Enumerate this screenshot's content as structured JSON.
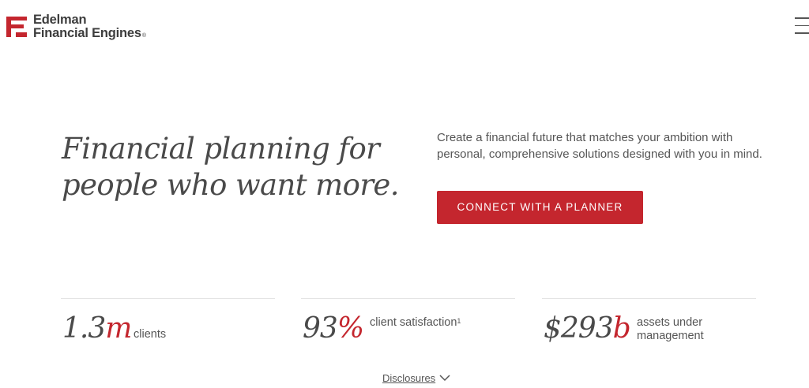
{
  "brand": {
    "name_line1": "Edelman",
    "name_line2": "Financial Engines",
    "registered": "®",
    "accent_color": "#c4262e"
  },
  "header": {
    "menu_icon": "hamburger-menu-icon"
  },
  "hero": {
    "headline_line1": "Financial planning for",
    "headline_line2": "people who want more.",
    "intro": "Create a financial future that matches your ambition with personal, comprehensive solutions designed with you in mind.",
    "cta_label": "CONNECT WITH A PLANNER"
  },
  "stats": [
    {
      "number": "1.3",
      "unit": "m",
      "label": "clients",
      "footnote": ""
    },
    {
      "number": "93",
      "unit": "%",
      "label": "client satisfaction",
      "footnote": "1"
    },
    {
      "number": "$293",
      "unit": "b",
      "label": "assets under management",
      "footnote": ""
    }
  ],
  "footer": {
    "disclosures_label": "Disclosures",
    "disclosures_icon": "chevron-down-icon"
  }
}
